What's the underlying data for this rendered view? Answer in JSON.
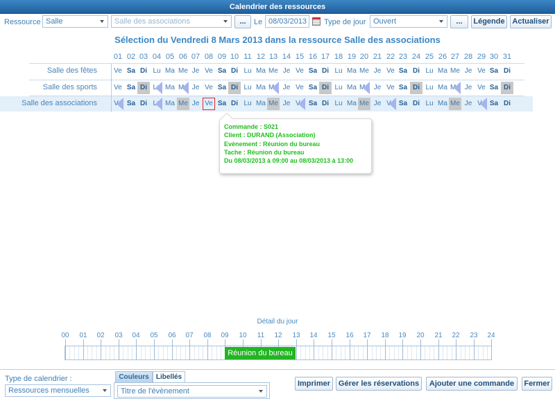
{
  "window": {
    "title": "Calendrier des ressources"
  },
  "toolbar": {
    "resource_label": "Ressource",
    "resource_type": "Salle",
    "resource_name": "Salle des associations",
    "more_label": "...",
    "date_label": "Le",
    "date_value": "08/03/2013",
    "daytype_label": "Type de jour",
    "daytype_value": "Ouvert",
    "more2_label": "...",
    "legend_label": "Légende",
    "refresh_label": "Actualiser"
  },
  "heading": "Sélection du Vendredi 8 Mars 2013 dans la ressource Salle des associations",
  "days": [
    "01",
    "02",
    "03",
    "04",
    "05",
    "06",
    "07",
    "08",
    "09",
    "10",
    "11",
    "12",
    "13",
    "14",
    "15",
    "16",
    "17",
    "18",
    "19",
    "20",
    "21",
    "22",
    "23",
    "24",
    "25",
    "26",
    "27",
    "28",
    "29",
    "30",
    "31"
  ],
  "weekdays": [
    "Ve",
    "Sa",
    "Di",
    "Lu",
    "Ma",
    "Me",
    "Je",
    "Ve",
    "Sa",
    "Di",
    "Lu",
    "Ma",
    "Me",
    "Je",
    "Ve",
    "Sa",
    "Di",
    "Lu",
    "Ma",
    "Me",
    "Je",
    "Ve",
    "Sa",
    "Di",
    "Lu",
    "Ma",
    "Me",
    "Je",
    "Ve",
    "Sa",
    "Di"
  ],
  "rows": [
    {
      "name": "Salle des fêtes",
      "grey": [],
      "tri": []
    },
    {
      "name": "Salle des sports",
      "grey": [
        3,
        10,
        17,
        24,
        31
      ],
      "tri": [
        4,
        6,
        13,
        20,
        27
      ]
    },
    {
      "name": "Salle des associations",
      "grey": [
        6,
        13,
        20,
        27
      ],
      "tri": [
        1,
        4,
        15,
        22,
        29
      ]
    }
  ],
  "selected_day": 8,
  "selected_row": 2,
  "tooltip": {
    "line1": "Commande : S021",
    "line2": "Client : DURAND (Association)",
    "line3": "Evènement : Réunion du bureau",
    "line4": "Tache : Réunion du bureau",
    "line5": "Du 08/03/2013 à 09:00 au 08/03/2013 à 13:00"
  },
  "detail": {
    "title": "Détail du jour",
    "hours": [
      "00",
      "01",
      "02",
      "03",
      "04",
      "05",
      "06",
      "07",
      "08",
      "09",
      "10",
      "11",
      "12",
      "13",
      "14",
      "15",
      "16",
      "17",
      "18",
      "19",
      "20",
      "21",
      "22",
      "23",
      "24"
    ],
    "event_label": "Réunion du bureau",
    "event_start_hour": 9,
    "event_end_hour": 13
  },
  "footer": {
    "calendar_type_label": "Type de calendrier :",
    "calendar_type_value": "Ressources mensuelles",
    "tab_colors": "Couleurs",
    "tab_labels": "Libellés",
    "label_select": "Titre de l'évènement",
    "print": "Imprimer",
    "manage": "Gérer les réservations",
    "add_order": "Ajouter une commande",
    "close": "Fermer"
  },
  "colors": {
    "accent": "#3a86c5",
    "event": "#22b522",
    "grey_cell": "#c8c8c8",
    "booking_marker": "#a5b4ee",
    "selection": "#e0242a"
  }
}
